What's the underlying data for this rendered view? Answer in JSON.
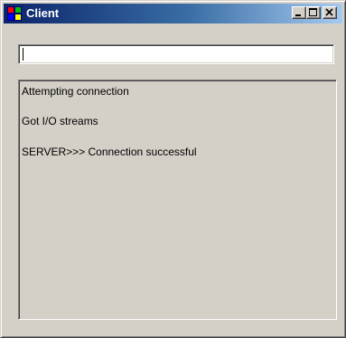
{
  "window": {
    "title": "Client",
    "icon": "windows-app-icon",
    "controls": {
      "minimize": "minimize-icon",
      "maximize": "maximize-icon",
      "close": "close-icon"
    }
  },
  "input": {
    "value": "",
    "placeholder": ""
  },
  "output": {
    "lines": [
      "Attempting connection",
      "Got I/O streams",
      "SERVER>>> Connection successful"
    ]
  },
  "colors": {
    "title_gradient_start": "#0a246a",
    "title_gradient_end": "#a6caf0",
    "window_face": "#d4d0c8"
  }
}
